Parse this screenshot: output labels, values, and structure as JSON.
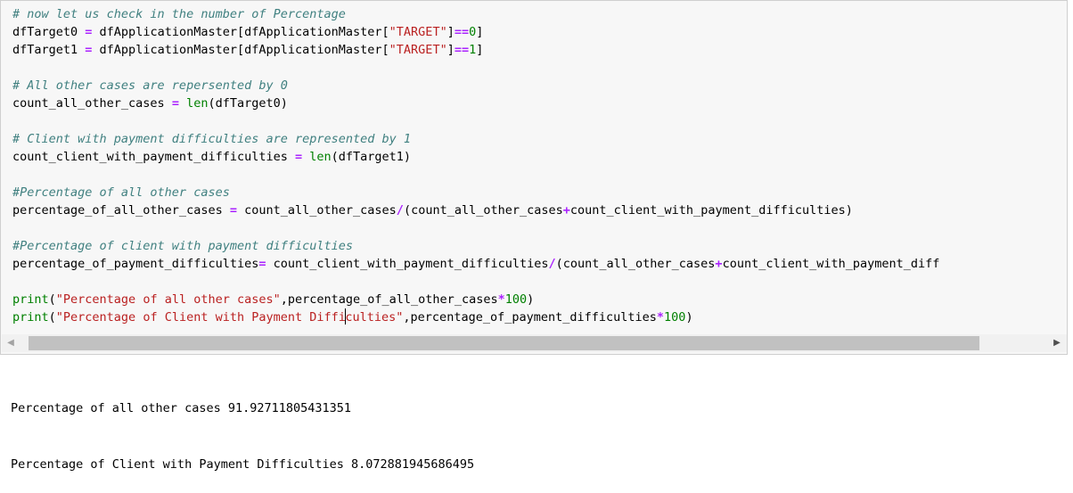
{
  "code_lines": [
    [
      {
        "t": "# now let us check in the number of Percentage",
        "c": "cm"
      }
    ],
    [
      {
        "t": "dfTarget0 "
      },
      {
        "t": "=",
        "c": "op"
      },
      {
        "t": " dfApplicationMaster[dfApplicationMaster["
      },
      {
        "t": "\"TARGET\"",
        "c": "st"
      },
      {
        "t": "]"
      },
      {
        "t": "==",
        "c": "op"
      },
      {
        "t": "0",
        "c": "nu"
      },
      {
        "t": "]"
      }
    ],
    [
      {
        "t": "dfTarget1 "
      },
      {
        "t": "=",
        "c": "op"
      },
      {
        "t": " dfApplicationMaster[dfApplicationMaster["
      },
      {
        "t": "\"TARGET\"",
        "c": "st"
      },
      {
        "t": "]"
      },
      {
        "t": "==",
        "c": "op"
      },
      {
        "t": "1",
        "c": "nu"
      },
      {
        "t": "]"
      }
    ],
    [],
    [
      {
        "t": "# All other cases are repersented by 0",
        "c": "cm"
      }
    ],
    [
      {
        "t": "count_all_other_cases "
      },
      {
        "t": "=",
        "c": "op"
      },
      {
        "t": " "
      },
      {
        "t": "len",
        "c": "nb"
      },
      {
        "t": "(dfTarget0)"
      }
    ],
    [],
    [
      {
        "t": "# Client with payment difficulties are represented by 1",
        "c": "cm"
      }
    ],
    [
      {
        "t": "count_client_with_payment_difficulties "
      },
      {
        "t": "=",
        "c": "op"
      },
      {
        "t": " "
      },
      {
        "t": "len",
        "c": "nb"
      },
      {
        "t": "(dfTarget1)"
      }
    ],
    [],
    [
      {
        "t": "#Percentage of all other cases",
        "c": "cm"
      }
    ],
    [
      {
        "t": "percentage_of_all_other_cases "
      },
      {
        "t": "=",
        "c": "op"
      },
      {
        "t": " count_all_other_cases"
      },
      {
        "t": "/",
        "c": "op"
      },
      {
        "t": "(count_all_other_cases"
      },
      {
        "t": "+",
        "c": "op"
      },
      {
        "t": "count_client_with_payment_difficulties)"
      }
    ],
    [],
    [
      {
        "t": "#Percentage of client with payment difficulties",
        "c": "cm"
      }
    ],
    [
      {
        "t": "percentage_of_payment_difficulties"
      },
      {
        "t": "=",
        "c": "op"
      },
      {
        "t": " count_client_with_payment_difficulties"
      },
      {
        "t": "/",
        "c": "op"
      },
      {
        "t": "(count_all_other_cases"
      },
      {
        "t": "+",
        "c": "op"
      },
      {
        "t": "count_client_with_payment_diff"
      }
    ],
    [],
    [
      {
        "t": "print",
        "c": "nb"
      },
      {
        "t": "("
      },
      {
        "t": "\"Percentage of all other cases\"",
        "c": "st"
      },
      {
        "t": ",percentage_of_all_other_cases"
      },
      {
        "t": "*",
        "c": "op"
      },
      {
        "t": "100",
        "c": "nu"
      },
      {
        "t": ")"
      }
    ],
    [
      {
        "t": "print",
        "c": "nb"
      },
      {
        "t": "("
      },
      {
        "t": "\"Percentage of Client with Payment Diffi",
        "c": "st"
      },
      {
        "t": "",
        "c": "cursor"
      },
      {
        "t": "culties\"",
        "c": "st"
      },
      {
        "t": ",percentage_of_payment_difficulties"
      },
      {
        "t": "*",
        "c": "op"
      },
      {
        "t": "100",
        "c": "nu"
      },
      {
        "t": ")"
      }
    ]
  ],
  "scrollbar": {
    "left_arrow": "◀",
    "right_arrow": "▶",
    "position_fraction": 0.0,
    "visible_fraction": 0.92
  },
  "output_lines": [
    "Percentage of all other cases 91.92711805431351",
    "Percentage of Client with Payment Difficulties 8.072881945686495"
  ]
}
